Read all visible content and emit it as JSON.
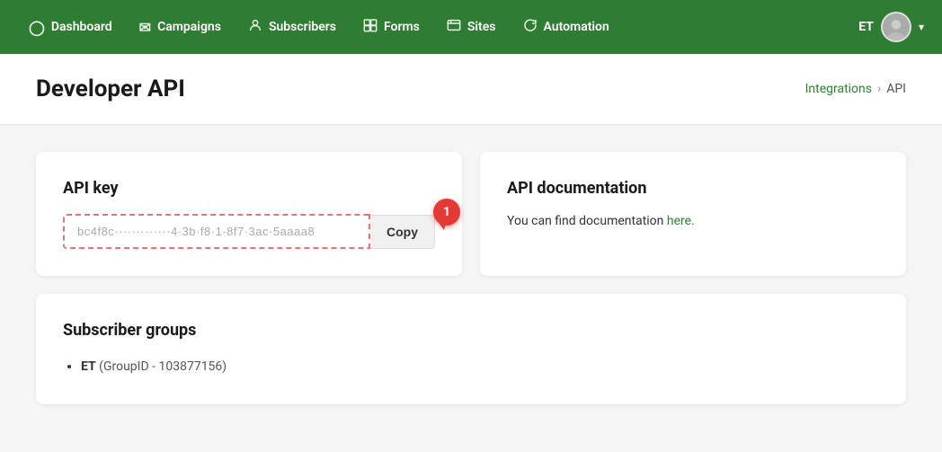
{
  "nav": {
    "items": [
      {
        "id": "dashboard",
        "label": "Dashboard",
        "icon": "⊙"
      },
      {
        "id": "campaigns",
        "label": "Campaigns",
        "icon": "✉"
      },
      {
        "id": "subscribers",
        "label": "Subscribers",
        "icon": "👤"
      },
      {
        "id": "forms",
        "label": "Forms",
        "icon": "⊞"
      },
      {
        "id": "sites",
        "label": "Sites",
        "icon": "▭"
      },
      {
        "id": "automation",
        "label": "Automation",
        "icon": "↻"
      }
    ],
    "user_initials": "ET",
    "chevron": "▾"
  },
  "header": {
    "title": "Developer API",
    "breadcrumb": {
      "parent": "Integrations",
      "separator": "›",
      "current": "API"
    }
  },
  "api_key_card": {
    "title": "API key",
    "key_placeholder": "••••••••••••••••••••••••••••••••••••••••••••",
    "key_value": "bc4f8c·············4·3b·f8·1·8f7·3ac·5aaaa8",
    "copy_label": "Copy",
    "step_badge": "1"
  },
  "api_docs_card": {
    "title": "API documentation",
    "description": "You can find documentation ",
    "link_text": "here.",
    "link_href": "#"
  },
  "subscriber_groups_card": {
    "title": "Subscriber groups",
    "groups": [
      {
        "name": "ET",
        "group_id_label": "GroupID - 103877156"
      }
    ]
  }
}
